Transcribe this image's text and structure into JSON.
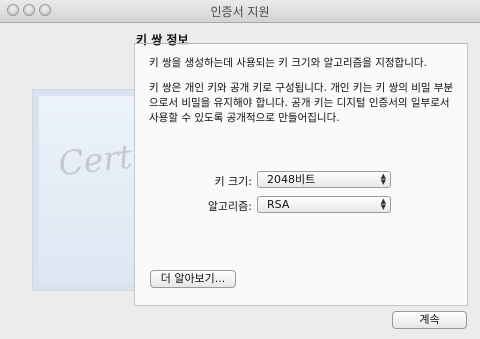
{
  "window": {
    "title": "인증서 지원"
  },
  "section": {
    "heading": "키 쌍 정보",
    "description1": "키 쌍을 생성하는데 사용되는 키 크기와 알고리즘을 지정합니다.",
    "description2": "키 쌍은 개인 키와 공개 키로 구성됩니다. 개인 키는 키 쌍의 비밀 부분으로서 비밀을 유지해야 합니다. 공개 키는 디지털 인증서의 일부로서 사용할 수 있도록 공개적으로 만들어집니다."
  },
  "fields": {
    "key_size_label": "키 크기:",
    "key_size_value": "2048비트",
    "algorithm_label": "알고리즘:",
    "algorithm_value": "RSA"
  },
  "buttons": {
    "learn_more": "더 알아보기...",
    "continue": "계속"
  },
  "illustration": {
    "certificate_text": "Certificate"
  }
}
